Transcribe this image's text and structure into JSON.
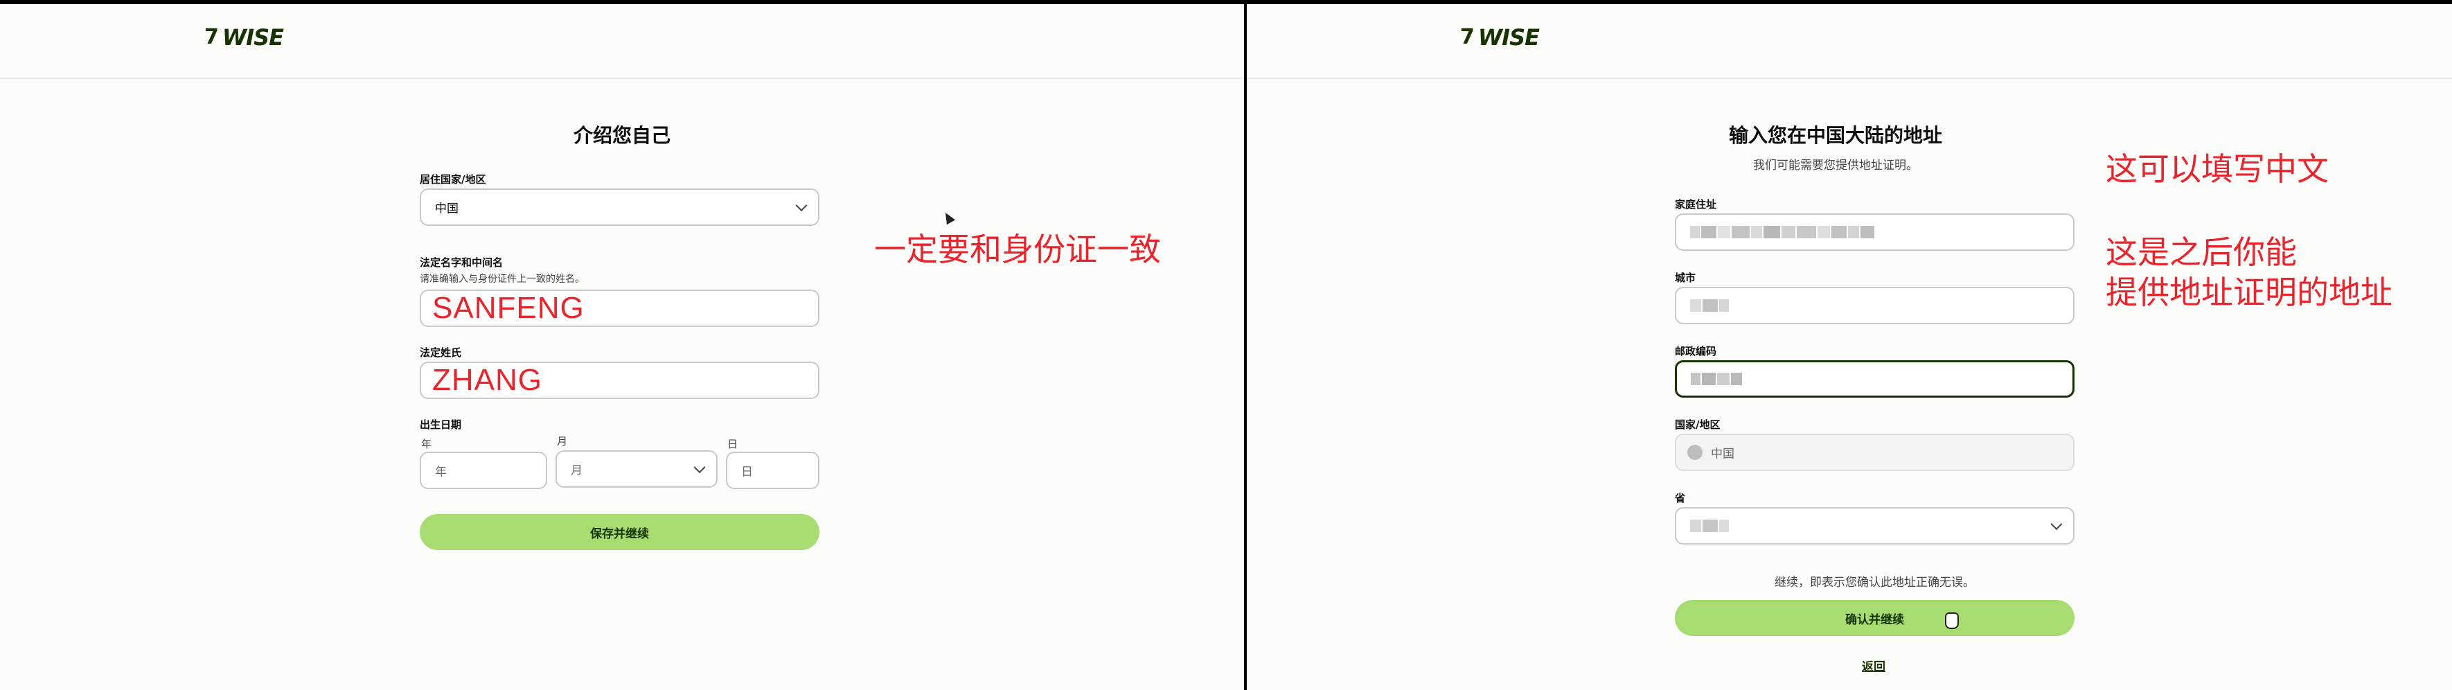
{
  "brand": {
    "name": "WISE",
    "flag_glyph": "7"
  },
  "left": {
    "title": "介绍您自己",
    "country_label": "居住国家/地区",
    "country_value": "中国",
    "given_name_label": "法定名字和中间名",
    "given_name_hint": "请准确输入与身份证件上一致的姓名。",
    "given_name_value": "SANFENG",
    "surname_label": "法定姓氏",
    "surname_value": "ZHANG",
    "dob_label": "出生日期",
    "year_label": "年",
    "year_placeholder": "年",
    "month_label": "月",
    "month_placeholder": "月",
    "day_label": "日",
    "day_placeholder": "日",
    "submit_label": "保存并继续",
    "annotation": "一定要和身份证一致"
  },
  "right": {
    "title": "输入您在中国大陆的地址",
    "subtitle": "我们可能需要您提供地址证明。",
    "address_label": "家庭住址",
    "city_label": "城市",
    "postcode_label": "邮政编码",
    "country_label": "国家/地区",
    "country_value": "中国",
    "province_label": "省",
    "confirm_note": "继续，即表示您确认此地址正确无误。",
    "submit_label": "确认并继续",
    "back_label": "返回",
    "annotation_1": "这可以填写中文",
    "annotation_2_line1": "这是之后你能",
    "annotation_2_line2": "提供地址证明的地址"
  },
  "colors": {
    "brand_green": "#163300",
    "button_green": "#a7dd70",
    "annotation_red": "#e8242c"
  },
  "icons": [
    "chevron-down-icon",
    "globe-icon",
    "mouse-pointer-icon",
    "hand-pointer-icon"
  ]
}
